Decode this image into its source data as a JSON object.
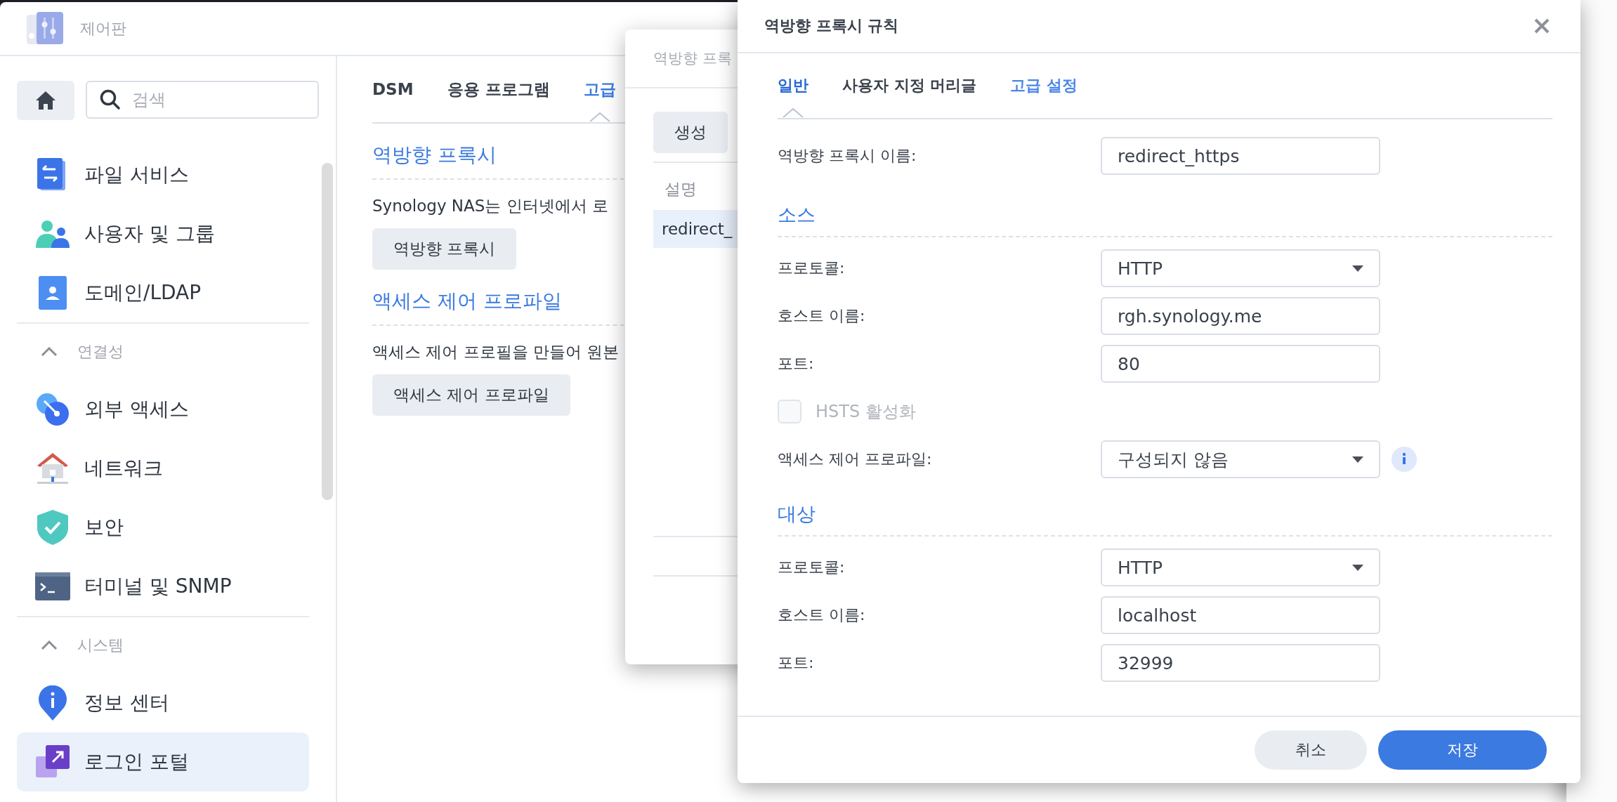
{
  "window": {
    "title": "제어판"
  },
  "sidebar": {
    "search": {
      "placeholder": "검색"
    },
    "sections": [
      {
        "items": [
          {
            "label": "파일 서비스",
            "selected": false
          },
          {
            "label": "사용자 및 그룹",
            "selected": false
          },
          {
            "label": "도메인/LDAP",
            "selected": false
          }
        ]
      },
      {
        "title": "연결성",
        "expanded": true,
        "items": [
          {
            "label": "외부 액세스",
            "selected": false
          },
          {
            "label": "네트워크",
            "selected": false
          },
          {
            "label": "보안",
            "selected": false
          },
          {
            "label": "터미널 및 SNMP",
            "selected": false
          }
        ]
      },
      {
        "title": "시스템",
        "expanded": true,
        "items": [
          {
            "label": "정보 센터",
            "selected": false
          },
          {
            "label": "로그인 포털",
            "selected": true
          }
        ]
      }
    ]
  },
  "main": {
    "tabs": [
      {
        "label": "DSM",
        "selected": false
      },
      {
        "label": "응용 프로그램",
        "selected": false
      },
      {
        "label": "고급",
        "selected": true
      }
    ],
    "sections": [
      {
        "heading": "역방향 프록시",
        "text": "Synology NAS는 인터넷에서 로",
        "button": "역방향 프록시"
      },
      {
        "heading": "액세스 제어 프로파일",
        "text": "액세스 제어 프로필을 만들어 원본",
        "button": "액세스 제어 프로파일"
      }
    ]
  },
  "background_dialog": {
    "title": "역방향 프록",
    "buttons": [
      "생성"
    ],
    "columns": [
      "설명"
    ],
    "rows": [
      {
        "cells": [
          "redirect_"
        ],
        "selected": true
      }
    ]
  },
  "dialog": {
    "title": "역방향 프록시 규칙",
    "tabs": [
      {
        "label": "일반",
        "selected": true,
        "highlighted": false
      },
      {
        "label": "사용자 지정 머리글",
        "selected": false,
        "highlighted": false
      },
      {
        "label": "고급 설정",
        "selected": false,
        "highlighted": true
      }
    ],
    "name_field": {
      "label": "역방향 프록시 이름:",
      "value": "redirect_https"
    },
    "groups": [
      {
        "heading": "소스",
        "fields": [
          {
            "kind": "select",
            "label": "프로토콜:",
            "value": "HTTP",
            "info": false
          },
          {
            "kind": "text",
            "label": "호스트 이름:",
            "value": "rgh.synology.me"
          },
          {
            "kind": "text",
            "label": "포트:",
            "value": "80"
          },
          {
            "kind": "checkbox",
            "label": "HSTS 활성화",
            "checked": false,
            "disabled": true
          },
          {
            "kind": "select",
            "label": "액세스 제어 프로파일:",
            "value": "구성되지 않음",
            "info": true
          }
        ]
      },
      {
        "heading": "대상",
        "fields": [
          {
            "kind": "select",
            "label": "프로토콜:",
            "value": "HTTP",
            "info": false
          },
          {
            "kind": "text",
            "label": "호스트 이름:",
            "value": "localhost"
          },
          {
            "kind": "text",
            "label": "포트:",
            "value": "32999"
          }
        ]
      }
    ],
    "buttons": [
      {
        "label": "취소",
        "kind": "secondary"
      },
      {
        "label": "저장",
        "kind": "primary"
      }
    ]
  }
}
